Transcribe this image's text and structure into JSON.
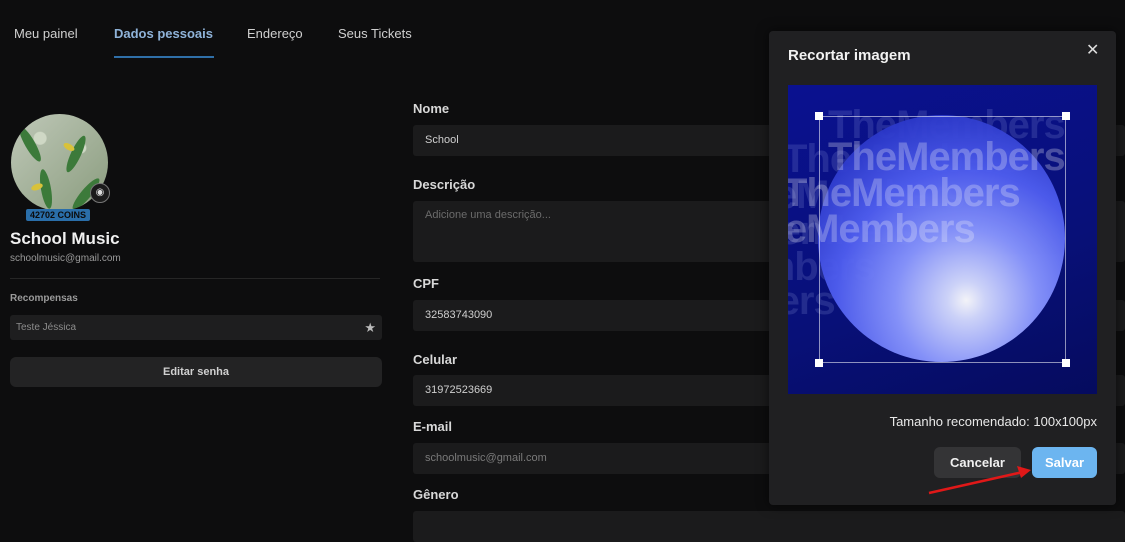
{
  "tabs": [
    {
      "label": "Meu painel"
    },
    {
      "label": "Dados pessoais"
    },
    {
      "label": "Endereço"
    },
    {
      "label": "Seus Tickets"
    }
  ],
  "profile": {
    "coins": "42702 COINS",
    "name": "School Music",
    "email": "schoolmusic@gmail.com",
    "rewards_label": "Recompensas",
    "reward_item": "Teste Jéssica",
    "edit_password": "Editar senha"
  },
  "form": {
    "name_label": "Nome",
    "name_value": "School",
    "description_label": "Descrição",
    "description_placeholder": "Adicione uma descrição...",
    "cpf_label": "CPF",
    "cpf_value": "32583743090",
    "phone_label": "Celular",
    "phone_value": "31972523669",
    "email_label": "E-mail",
    "email_value": "schoolmusic@gmail.com",
    "gender_label": "Gênero"
  },
  "modal": {
    "title": "Recortar imagem",
    "watermark_text": "TheMembers",
    "recommended": "Tamanho recomendado: 100x100px",
    "cancel_label": "Cancelar",
    "save_label": "Salvar"
  },
  "colors": {
    "accent": "#6cb5f0",
    "active_tab": "#8fb3d9",
    "annotation_arrow": "#e01818"
  }
}
